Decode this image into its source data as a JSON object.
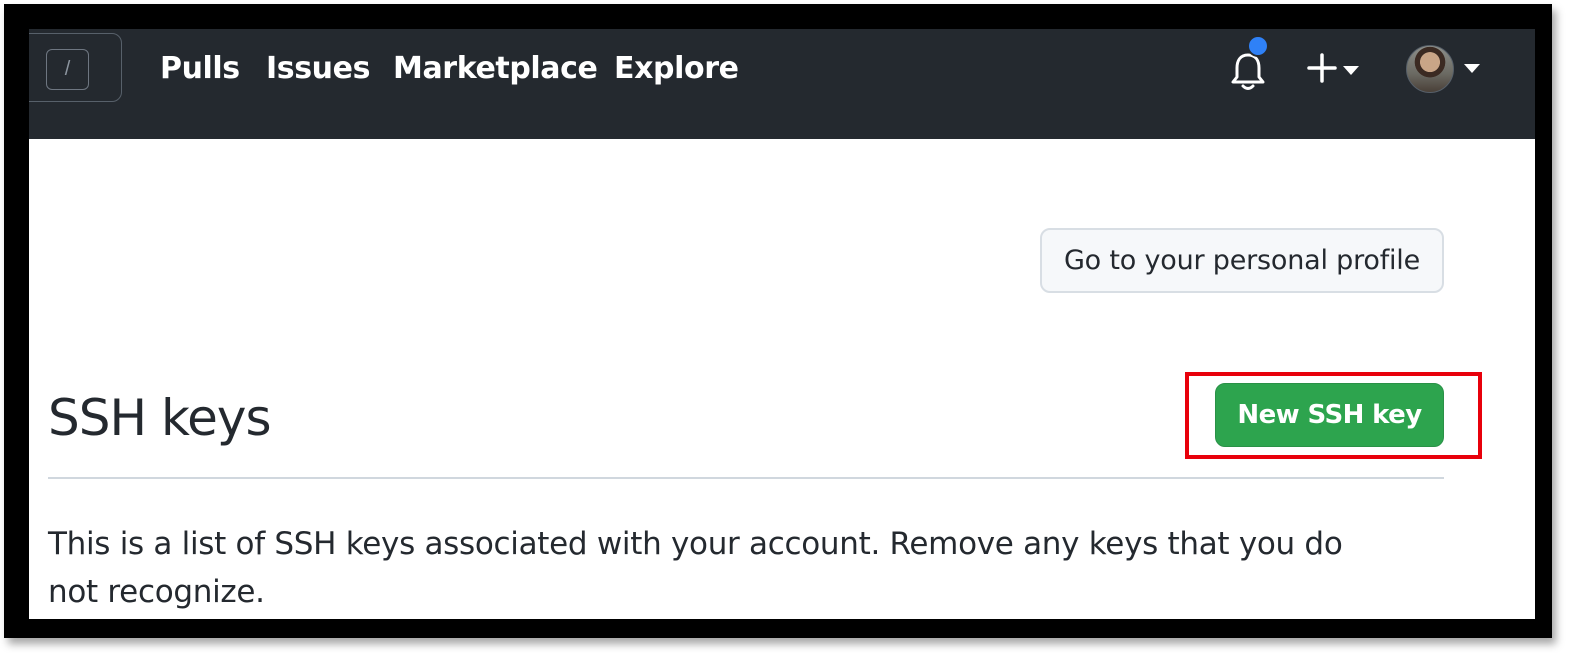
{
  "header": {
    "search_key_hint": "/",
    "nav": [
      {
        "label": "Pulls"
      },
      {
        "label": "Issues"
      },
      {
        "label": "Marketplace"
      },
      {
        "label": "Explore"
      }
    ],
    "icons": {
      "notifications": "bell-icon",
      "create": "plus-icon",
      "dropdown": "chevron-down-icon"
    },
    "notification_dot_color": "#2f81f7"
  },
  "main": {
    "profile_button_label": "Go to your personal profile",
    "title": "SSH keys",
    "new_key_button_label": "New SSH key",
    "new_key_button_color": "#2da44e",
    "highlight_color": "#e8000b",
    "description": "This is a list of SSH keys associated with your account. Remove any keys that you do not recognize."
  }
}
